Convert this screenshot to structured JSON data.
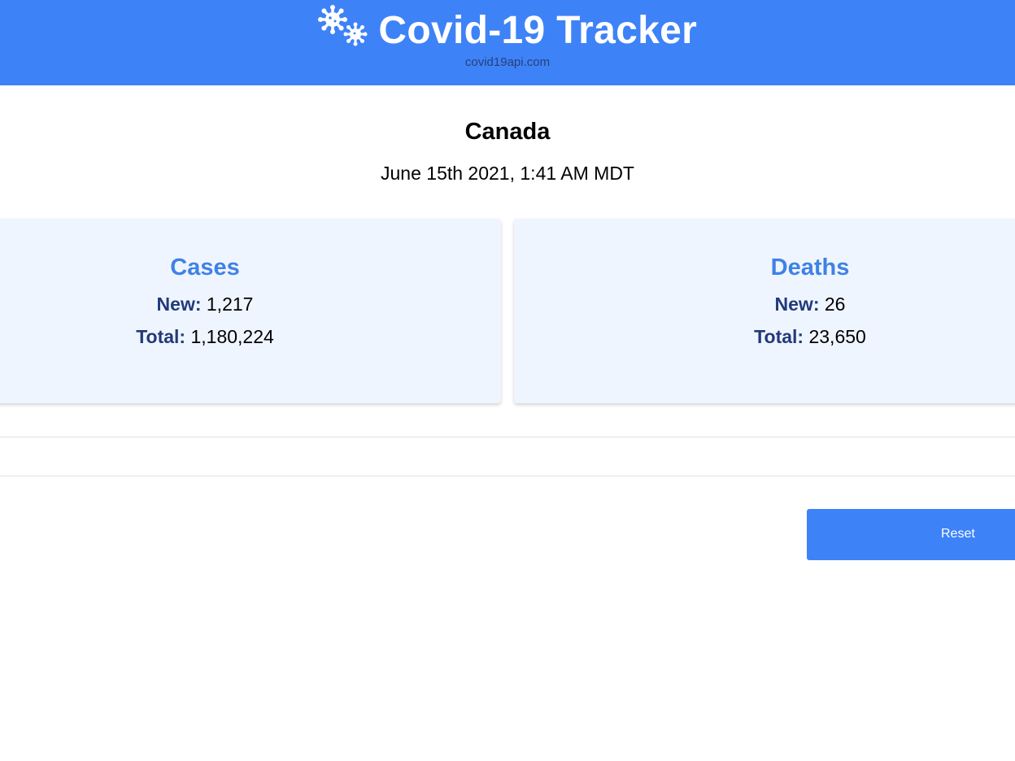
{
  "header": {
    "logo_icon": "virus-icon",
    "title": "Covid-19 Tracker",
    "subtitle": "covid19api.com",
    "background": "#3e82f7"
  },
  "location": {
    "country": "Canada",
    "datetime": "June 15th 2021, 1:41 AM MDT"
  },
  "cards": [
    {
      "title": "Cases",
      "new_label": "New:",
      "new_value": "1,217",
      "total_label": "Total:",
      "total_value": "1,180,224"
    },
    {
      "title": "Deaths",
      "new_label": "New:",
      "new_value": "26",
      "total_label": "Total:",
      "total_value": "23,650"
    }
  ],
  "actions": {
    "reset_label": "Reset"
  },
  "colors": {
    "accent": "#3e82f7",
    "card_background": "#eff5fe",
    "card_title": "#3e82e6",
    "label": "#223a7a"
  }
}
